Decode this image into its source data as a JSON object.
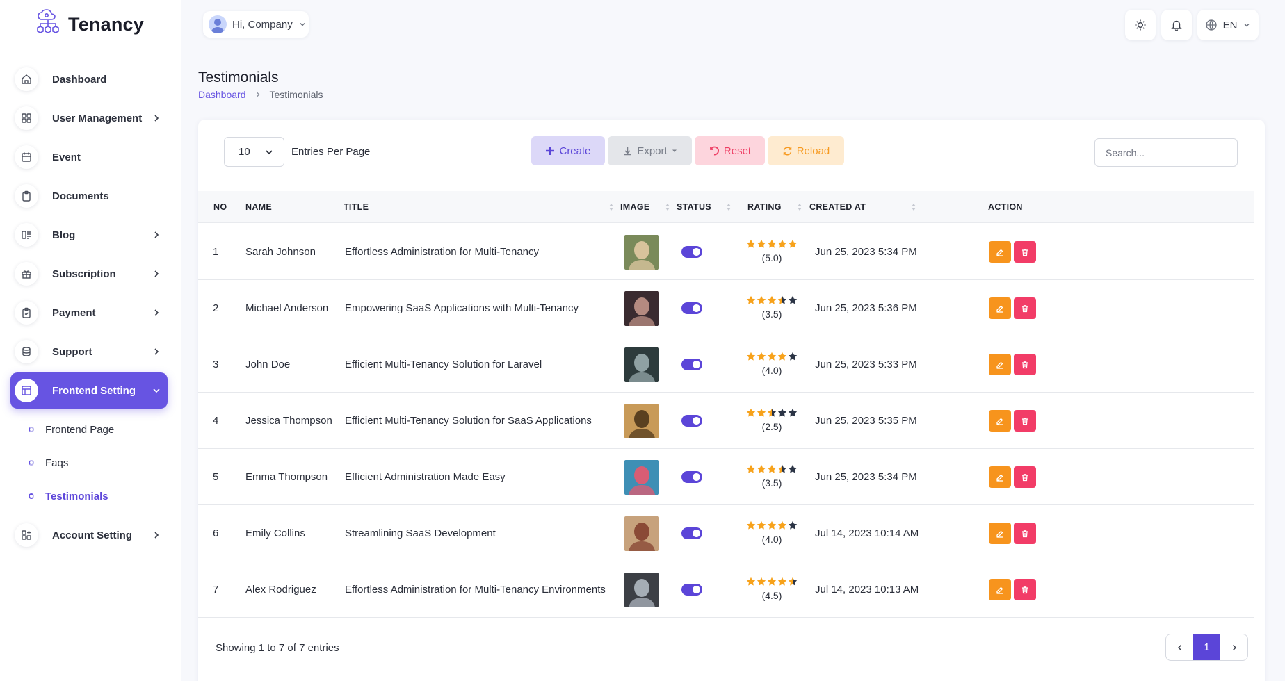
{
  "app": {
    "name": "Tenancy"
  },
  "topbar": {
    "greeting": "Hi, Company",
    "language": "EN"
  },
  "sidebar": {
    "items": [
      {
        "label": "Dashboard",
        "icon": "home-icon",
        "has_children": false
      },
      {
        "label": "User Management",
        "icon": "grid-icon",
        "has_children": true
      },
      {
        "label": "Event",
        "icon": "calendar-icon",
        "has_children": false
      },
      {
        "label": "Documents",
        "icon": "clipboard-icon",
        "has_children": false
      },
      {
        "label": "Blog",
        "icon": "blog-icon",
        "has_children": true
      },
      {
        "label": "Subscription",
        "icon": "gift-icon",
        "has_children": true
      },
      {
        "label": "Payment",
        "icon": "payment-icon",
        "has_children": true
      },
      {
        "label": "Support",
        "icon": "database-icon",
        "has_children": true
      },
      {
        "label": "Frontend Setting",
        "icon": "layout-icon",
        "has_children": true,
        "active": true
      },
      {
        "label": "Account Setting",
        "icon": "settings-grid-icon",
        "has_children": true
      }
    ],
    "frontend_sub": [
      {
        "label": "Frontend Page",
        "active": false
      },
      {
        "label": "Faqs",
        "active": false
      },
      {
        "label": "Testimonials",
        "active": true
      }
    ]
  },
  "page": {
    "title": "Testimonials",
    "breadcrumb": {
      "home": "Dashboard",
      "current": "Testimonials"
    }
  },
  "toolbar": {
    "entries_value": "10",
    "entries_label": "Entries Per Page",
    "create": "Create",
    "export": "Export",
    "reset": "Reset",
    "reload": "Reload",
    "search_placeholder": "Search..."
  },
  "table": {
    "headers": [
      "NO",
      "NAME",
      "TITLE",
      "IMAGE",
      "STATUS",
      "RATING",
      "CREATED AT",
      "ACTION"
    ],
    "rows": [
      {
        "no": "1",
        "name": "Sarah Johnson",
        "title": "Effortless Administration for Multi-Tenancy",
        "rating": 5.0,
        "rating_text": "(5.0)",
        "created": "Jun 25, 2023 5:34 PM",
        "status_on": true
      },
      {
        "no": "2",
        "name": "Michael Anderson",
        "title": "Empowering SaaS Applications with Multi-Tenancy",
        "rating": 3.5,
        "rating_text": "(3.5)",
        "created": "Jun 25, 2023 5:36 PM",
        "status_on": true
      },
      {
        "no": "3",
        "name": "John Doe",
        "title": "Efficient Multi-Tenancy Solution for Laravel",
        "rating": 4.0,
        "rating_text": "(4.0)",
        "created": "Jun 25, 2023 5:33 PM",
        "status_on": true
      },
      {
        "no": "4",
        "name": "Jessica Thompson",
        "title": "Efficient Multi-Tenancy Solution for SaaS Applications",
        "rating": 2.5,
        "rating_text": "(2.5)",
        "created": "Jun 25, 2023 5:35 PM",
        "status_on": true
      },
      {
        "no": "5",
        "name": "Emma Thompson",
        "title": "Efficient Administration Made Easy",
        "rating": 3.5,
        "rating_text": "(3.5)",
        "created": "Jun 25, 2023 5:34 PM",
        "status_on": true
      },
      {
        "no": "6",
        "name": "Emily Collins",
        "title": "Streamlining SaaS Development",
        "rating": 4.0,
        "rating_text": "(4.0)",
        "created": "Jul 14, 2023 10:14 AM",
        "status_on": true
      },
      {
        "no": "7",
        "name": "Alex Rodriguez",
        "title": "Effortless Administration for Multi-Tenancy Environments",
        "rating": 4.5,
        "rating_text": "(4.5)",
        "created": "Jul 14, 2023 10:13 AM",
        "status_on": true
      }
    ]
  },
  "footer": {
    "info": "Showing 1 to 7 of 7 entries",
    "current_page": "1"
  },
  "colors": {
    "accent": "#6754e2",
    "star": "#f7a21b",
    "star_empty": "#2b3445",
    "edit": "#f7941d",
    "delete": "#f23c67"
  }
}
